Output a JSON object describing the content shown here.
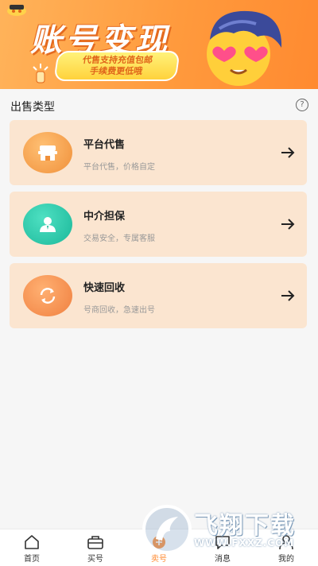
{
  "banner": {
    "title": "账号变现",
    "slogan_line1": "代售支持充值包邮",
    "slogan_line2": "手续费更低哦"
  },
  "section": {
    "title": "出售类型",
    "help_icon": "question-icon"
  },
  "cards": [
    {
      "name": "平台代售",
      "desc": "平台代售，价格自定",
      "icon": "store-icon",
      "color": "#f5a24a"
    },
    {
      "name": "中介担保",
      "desc": "交易安全，专属客服",
      "icon": "agent-icon",
      "color": "#27c2a3"
    },
    {
      "name": "快速回收",
      "desc": "号商回收，急速出号",
      "icon": "recycle-icon",
      "color": "#f5914a"
    }
  ],
  "tabbar": {
    "items": [
      {
        "label": "首页",
        "icon": "home-icon"
      },
      {
        "label": "买号",
        "icon": "bag-icon"
      },
      {
        "label": "卖号",
        "icon": "sell-icon"
      },
      {
        "label": "消息",
        "icon": "message-icon"
      },
      {
        "label": "我的",
        "icon": "profile-icon"
      }
    ],
    "active_index": 2,
    "active_color": "#ff8a30"
  },
  "watermark": {
    "title": "飞翔下载",
    "url": "WWW.FXXZ.COM"
  }
}
